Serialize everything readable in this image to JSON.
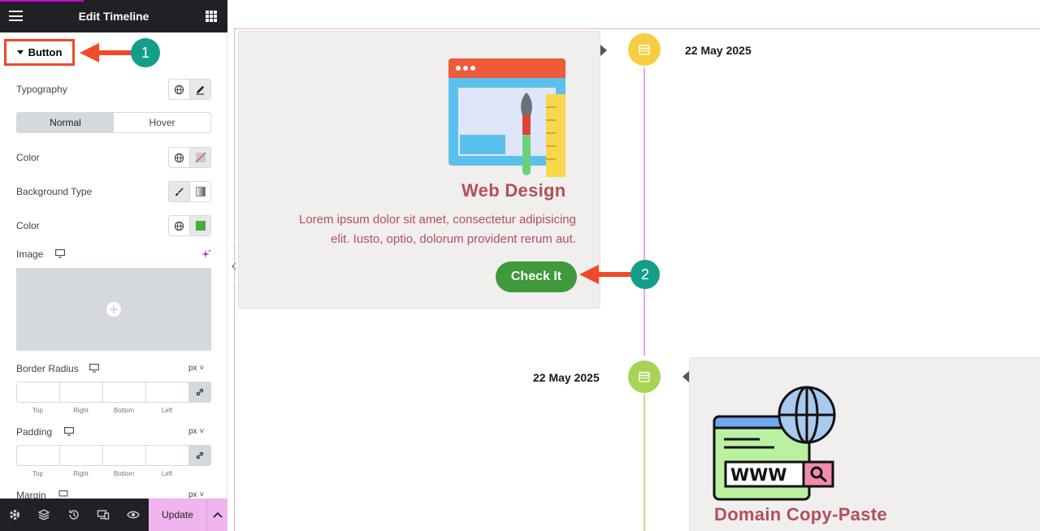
{
  "panel": {
    "title": "Edit Timeline",
    "section_label": "Button",
    "typography_label": "Typography",
    "tabs": [
      "Normal",
      "Hover"
    ],
    "color_label": "Color",
    "background_type_label": "Background Type",
    "bg_color_label": "Color",
    "bg_color_swatch": "#4cab3f",
    "image_label": "Image",
    "border_radius_label": "Border Radius",
    "padding_label": "Padding",
    "margin_label": "Margin",
    "unit": "px",
    "dim_labels": [
      "Top",
      "Right",
      "Bottom",
      "Left"
    ]
  },
  "footer": {
    "update_label": "Update",
    "icons": [
      "settings-icon",
      "layers-icon",
      "history-icon",
      "responsive-icon",
      "preview-icon"
    ]
  },
  "annotations": [
    "1",
    "2"
  ],
  "timeline": {
    "items": [
      {
        "date": "22 May 2025",
        "title": "Web Design",
        "description": [
          "Lorem ipsum dolor sit amet, consectetur adipisicing",
          "elit. Iusto, optio, dolorum provident rerum aut."
        ],
        "button_label": "Check It",
        "dot_color": "#f7cd42"
      },
      {
        "date": "22 May 2025",
        "title": "Domain Copy-Paste",
        "dot_color": "#a8d356"
      }
    ],
    "title_color": "#b24f5d",
    "button_color": "#3e9a3a"
  }
}
